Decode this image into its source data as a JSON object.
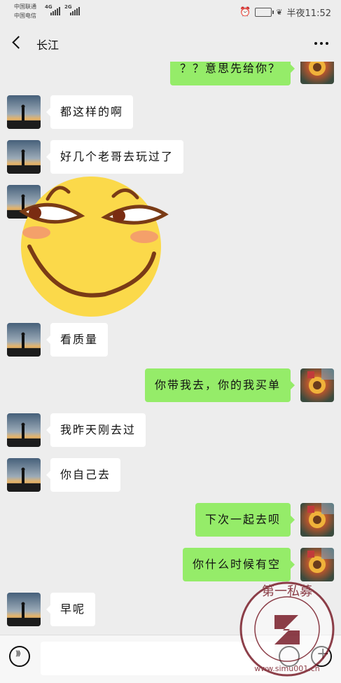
{
  "status_bar": {
    "carrier1": "中国联通",
    "carrier2": "中国电信",
    "net1": "4G",
    "net2": "2G",
    "battery": "",
    "time_label": "半夜11:52"
  },
  "header": {
    "title": "长江"
  },
  "messages": [
    {
      "side": "out",
      "text": "？？意思先给你？"
    },
    {
      "side": "in",
      "text": "都这样的啊"
    },
    {
      "side": "in",
      "text": "好几个老哥去玩过了"
    },
    {
      "side": "in",
      "text": "",
      "sticker": "smirk-face-sticker"
    },
    {
      "side": "in",
      "text": "看质量"
    },
    {
      "side": "out",
      "text": "你带我去，你的我买单"
    },
    {
      "side": "in",
      "text": "我昨天刚去过"
    },
    {
      "side": "in",
      "text": "你自己去"
    },
    {
      "side": "out",
      "text": "下次一起去呗"
    },
    {
      "side": "out",
      "text": "你什么时候有空"
    },
    {
      "side": "in",
      "text": "早呢"
    }
  ],
  "input": {
    "value": "",
    "placeholder": ""
  },
  "watermark": {
    "top_text": "第一私募",
    "bottom_text": "www.simu001.cn"
  },
  "colors": {
    "background": "#ededed",
    "incoming_bubble": "#ffffff",
    "outgoing_bubble": "#95ec69"
  }
}
